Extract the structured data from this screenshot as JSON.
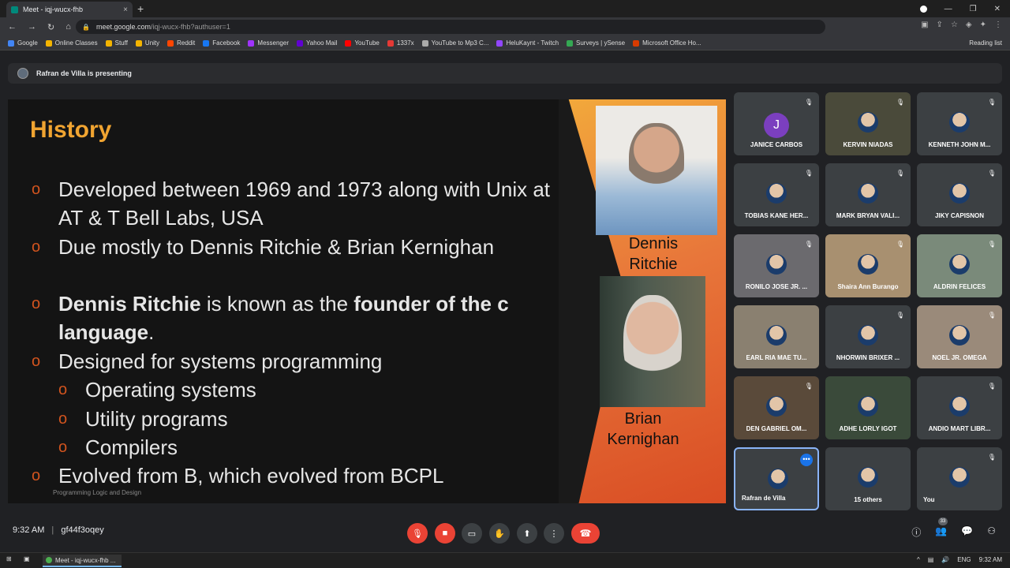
{
  "browser": {
    "tab_title": "Meet - iqj-wucx-fhb",
    "tab_close": "×",
    "new_tab": "+",
    "url_host": "meet.google.com",
    "url_path": "/iqj-wucx-fhb?authuser=1",
    "bookmarks": [
      "Google",
      "Online Classes",
      "Stuff",
      "Unity",
      "Reddit",
      "Facebook",
      "Messenger",
      "Yahoo Mail",
      "YouTube",
      "1337x",
      "YouTube to Mp3 C...",
      "HeluKaynt - Twitch",
      "Surveys | ySense",
      "Microsoft Office Ho..."
    ],
    "bookmark_colors": [
      "#4285f4",
      "#f4b400",
      "#f4b400",
      "#f4b400",
      "#ff4500",
      "#1877f2",
      "#a033ff",
      "#6001d2",
      "#ff0000",
      "#e53935",
      "#aaaaaa",
      "#9146ff",
      "#34a853",
      "#d83b01"
    ],
    "reading_list": "Reading list"
  },
  "meet": {
    "presenting_text": "Rafran de Villa is presenting",
    "time": "9:32 AM",
    "meeting_code": "gf44f3oqey",
    "participant_count": "33"
  },
  "slide": {
    "title": "History",
    "b1": "Developed between 1969 and 1973  along with Unix at AT & T Bell Labs,  USA",
    "b2": "Due mostly to Dennis Ritchie & Brian Kernighan",
    "b3_bold": "Dennis Ritchie",
    "b3_mid": " is known as the ",
    "b3_bold2": "founder of the c language",
    "b3_end": ".",
    "b4": "Designed for systems programming",
    "s1": "Operating systems",
    "s2": "Utility programs",
    "s3": "Compilers",
    "b5": "Evolved from B, which evolved from BCPL",
    "cap1": "Dennis Ritchie",
    "cap2": "Brian Kernighan",
    "footer": "Programming Logic and Design",
    "bullet_marker": "o"
  },
  "participants": [
    {
      "name": "JANICE CARBOS"
    },
    {
      "name": "KERVIN NIADAS"
    },
    {
      "name": "KENNETH JOHN M..."
    },
    {
      "name": "TOBIAS KANE HER..."
    },
    {
      "name": "MARK BRYAN VALI..."
    },
    {
      "name": "JIKY CAPISNON"
    },
    {
      "name": "RONILO JOSE JR. ..."
    },
    {
      "name": "Shaira Ann Burango"
    },
    {
      "name": "ALDRIN FELICES"
    },
    {
      "name": "EARL RIA MAE TU..."
    },
    {
      "name": "NHORWIN BRIXER ..."
    },
    {
      "name": "NOEL JR. OMEGA"
    },
    {
      "name": "DEN GABRIEL OM..."
    },
    {
      "name": "ADHE LORLY IGOT"
    },
    {
      "name": "ANDIO MART LIBR..."
    },
    {
      "name": "Rafran de Villa"
    },
    {
      "name": "15 others"
    },
    {
      "name": "You"
    }
  ],
  "avatar_initial": "J",
  "taskbar": {
    "item": "Meet - iqj-wucx-fhb ...",
    "lang": "ENG",
    "time": "9:32 AM"
  }
}
